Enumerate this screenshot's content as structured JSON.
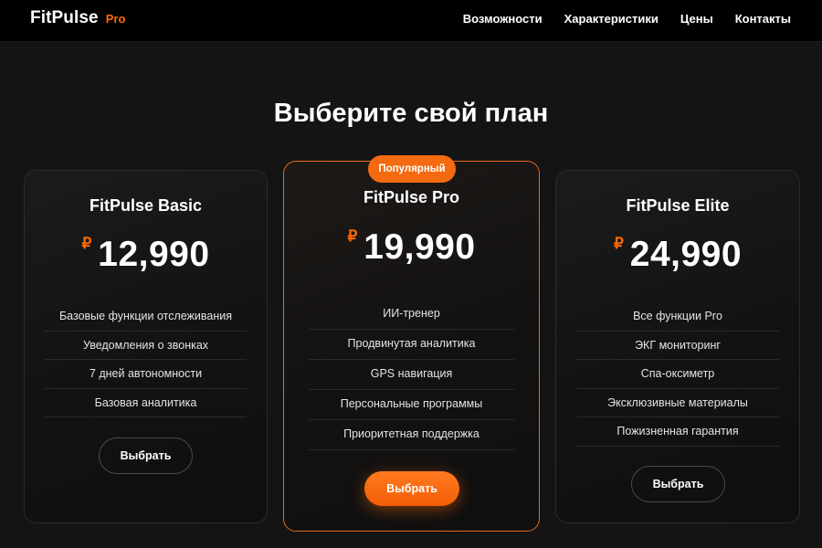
{
  "nav": {
    "brand": "FitPulse",
    "brand_badge": "Pro",
    "links": [
      "Возможности",
      "Характеристики",
      "Цены",
      "Контакты"
    ]
  },
  "section_title": "Выберите свой план",
  "colors": {
    "accent": "#ff6a00",
    "background": "#141414",
    "navbar": "#000000"
  },
  "plans": [
    {
      "name": "FitPulse Basic",
      "currency": "₽",
      "price": "12,990",
      "features": [
        "Базовые функции отслеживания",
        "Уведомления о звонках",
        "7 дней автономности",
        "Базовая аналитика"
      ],
      "button": "Выбрать"
    },
    {
      "name": "FitPulse Pro",
      "badge": "Популярный",
      "currency": "₽",
      "price": "19,990",
      "features": [
        "ИИ-тренер",
        "Продвинутая аналитика",
        "GPS навигация",
        "Персональные программы",
        "Приоритетная поддержка"
      ],
      "button": "Выбрать"
    },
    {
      "name": "FitPulse Elite",
      "currency": "₽",
      "price": "24,990",
      "features": [
        "Все функции Pro",
        "ЭКГ мониторинг",
        "Спа-оксиметр",
        "Эксклюзивные материалы",
        "Пожизненная гарантия"
      ],
      "button": "Выбрать"
    }
  ]
}
